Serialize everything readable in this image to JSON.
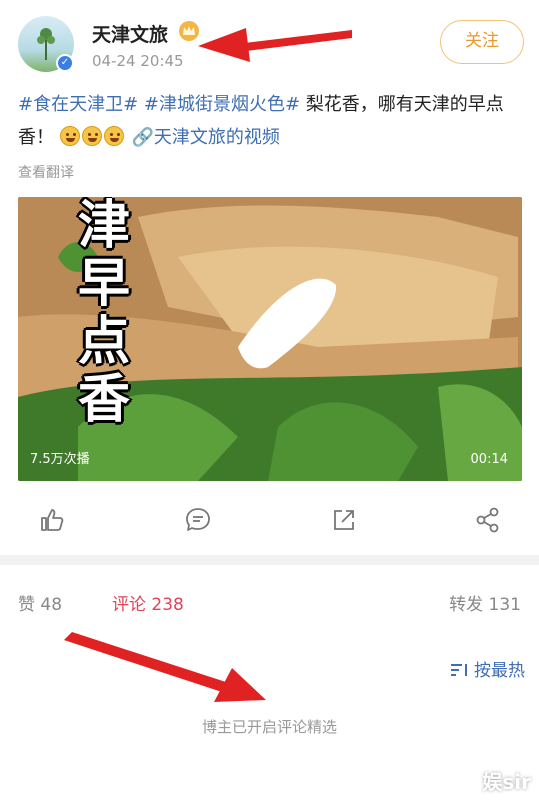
{
  "post": {
    "author": "天津文旅",
    "time": "04-24 20:45",
    "follow_label": "关注",
    "text_parts": {
      "tag1": "#食在天津卫#",
      "tag2": "#津城街景烟火色#",
      "body1": "梨花香，哪有天津的早点",
      "body2": "香！",
      "link": "天津文旅的",
      "link_tail": "视频"
    },
    "translate": "查看翻译",
    "video": {
      "title": "津早点香",
      "views": "7.5万次播",
      "duration": "00:14"
    }
  },
  "actions": {
    "icons": [
      "thumbs-up-icon",
      "comment-icon",
      "share-edit-icon",
      "share-icon"
    ]
  },
  "stats": {
    "like": "赞 48",
    "comment": "评论 238",
    "repost": "转发 131"
  },
  "comments": {
    "sort_label": "按最热",
    "notice": "博主已开启评论精选"
  },
  "watermark": "娱sir",
  "colors": {
    "accent_blue": "#3f6eb3",
    "follow_orange": "#e99a2c",
    "comment_red": "#e0455a",
    "arrow_red": "#e02222"
  }
}
